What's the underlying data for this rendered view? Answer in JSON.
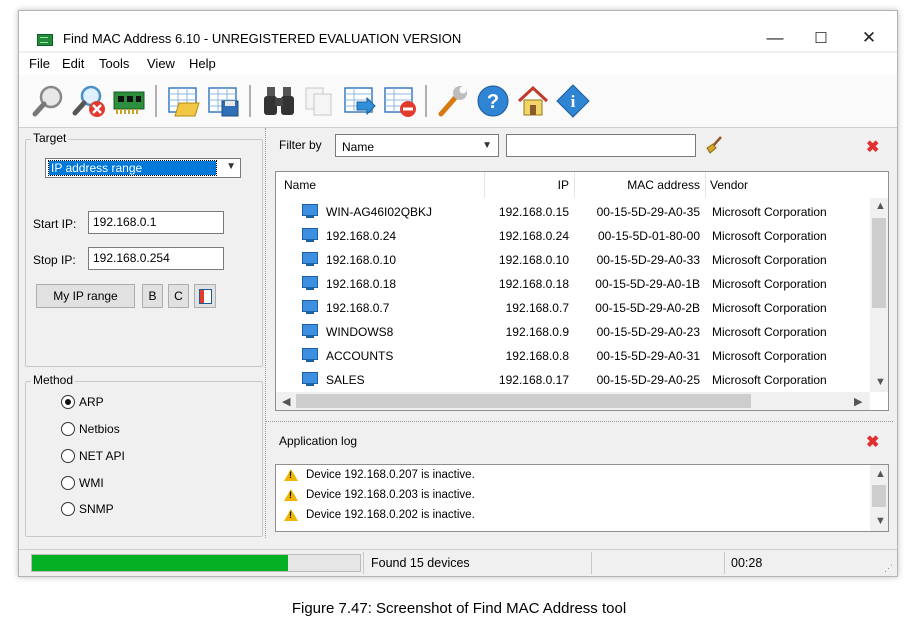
{
  "window": {
    "title": "Find MAC Address 6.10 - UNREGISTERED EVALUATION VERSION",
    "minimize_glyph": "—",
    "maximize_glyph": "☐",
    "close_glyph": "✕"
  },
  "menu": [
    "File",
    "Edit",
    "Tools",
    "View",
    "Help"
  ],
  "toolbar": {
    "icons": [
      "find-icon",
      "stop-find-icon",
      "network-card-icon",
      "open-file-icon",
      "save-file-icon",
      "binoculars-icon",
      "copy-icon",
      "export-icon",
      "delete-list-icon",
      "wrench-icon",
      "help-icon",
      "home-icon",
      "info-icon"
    ]
  },
  "target": {
    "legend": "Target",
    "selected": "IP address range",
    "start_label": "Start IP:",
    "start_value": "192.168.0.1",
    "stop_label": "Stop IP:",
    "stop_value": "192.168.0.254",
    "my_ip_range_label": "My IP range",
    "b_label": "B",
    "c_label": "C"
  },
  "method": {
    "legend": "Method",
    "options": [
      {
        "label": "ARP",
        "selected": true
      },
      {
        "label": "Netbios",
        "selected": false
      },
      {
        "label": "NET API",
        "selected": false
      },
      {
        "label": "WMI",
        "selected": false
      },
      {
        "label": "SNMP",
        "selected": false
      }
    ]
  },
  "filter": {
    "label": "Filter by",
    "selected": "Name",
    "text": ""
  },
  "devices": {
    "columns": [
      "Name",
      "IP",
      "MAC address",
      "Vendor"
    ],
    "rows": [
      [
        "WIN-AG46I02QBKJ",
        "192.168.0.15",
        "00-15-5D-29-A0-35",
        "Microsoft Corporation"
      ],
      [
        "192.168.0.24",
        "192.168.0.24",
        "00-15-5D-01-80-00",
        "Microsoft Corporation"
      ],
      [
        "192.168.0.10",
        "192.168.0.10",
        "00-15-5D-29-A0-33",
        "Microsoft Corporation"
      ],
      [
        "192.168.0.18",
        "192.168.0.18",
        "00-15-5D-29-A0-1B",
        "Microsoft Corporation"
      ],
      [
        "192.168.0.7",
        "192.168.0.7",
        "00-15-5D-29-A0-2B",
        "Microsoft Corporation"
      ],
      [
        "WINDOWS8",
        "192.168.0.9",
        "00-15-5D-29-A0-23",
        "Microsoft Corporation"
      ],
      [
        "ACCOUNTS",
        "192.168.0.8",
        "00-15-5D-29-A0-31",
        "Microsoft Corporation"
      ],
      [
        "SALES",
        "192.168.0.17",
        "00-15-5D-29-A0-25",
        "Microsoft Corporation"
      ]
    ]
  },
  "log": {
    "title": "Application log",
    "lines": [
      "Device 192.168.0.207 is inactive.",
      "Device 192.168.0.203 is inactive.",
      "Device 192.168.0.202 is inactive."
    ]
  },
  "status": {
    "progress_fraction": 0.78,
    "found": "Found 15 devices",
    "elapsed": "00:28"
  },
  "caption": "Figure 7.47: Screenshot of Find MAC Address tool",
  "colors": {
    "progress": "#06b025",
    "selection": "#0078d7",
    "close_red": "#e03030"
  }
}
